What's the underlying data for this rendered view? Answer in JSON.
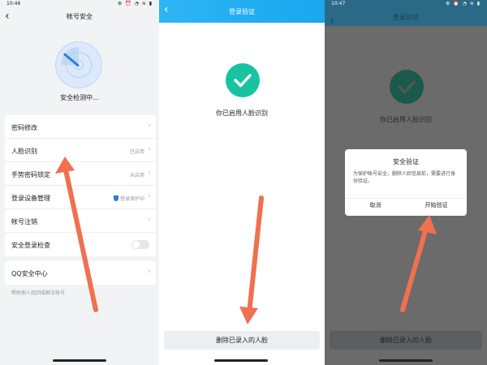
{
  "panel1": {
    "status": {
      "time": "10:46",
      "icons": "⚙ ⏰ ◔ ≋ ▮"
    },
    "title": "帐号安全",
    "detect_label": "安全检测中...",
    "rows": [
      {
        "label": "密码修改",
        "value": ""
      },
      {
        "label": "人脸识别",
        "value": "已启用"
      },
      {
        "label": "手势密码锁定",
        "value": "未启用"
      },
      {
        "label": "登录设备管理",
        "value": "登录保护中"
      },
      {
        "label": "帐号注销",
        "value": ""
      },
      {
        "label": "安全登录检查",
        "value": ""
      }
    ],
    "qq_center": "QQ安全中心",
    "hint": "帮助他人找回或解冻帐号"
  },
  "panel2": {
    "title": "登录验证",
    "enabled_text": "你已启用人脸识别",
    "bottom_button": "删除已录入的人脸"
  },
  "panel3": {
    "status": {
      "time": "10:47",
      "icons": "⚙ ⏰ ◔ ≋ ▮"
    },
    "title": "登录验证",
    "enabled_text": "你已启用人脸识别",
    "bottom_button": "删除已录入的人脸",
    "dialog": {
      "title": "安全验证",
      "message": "为保护帐号安全，删除人脸信息前，需要进行身份验证。",
      "cancel": "取消",
      "confirm": "开始验证"
    }
  },
  "colors": {
    "accent_blue": "#1aa8ef",
    "check_green": "#17c3a0",
    "annotation_arrow": "#f07050"
  }
}
